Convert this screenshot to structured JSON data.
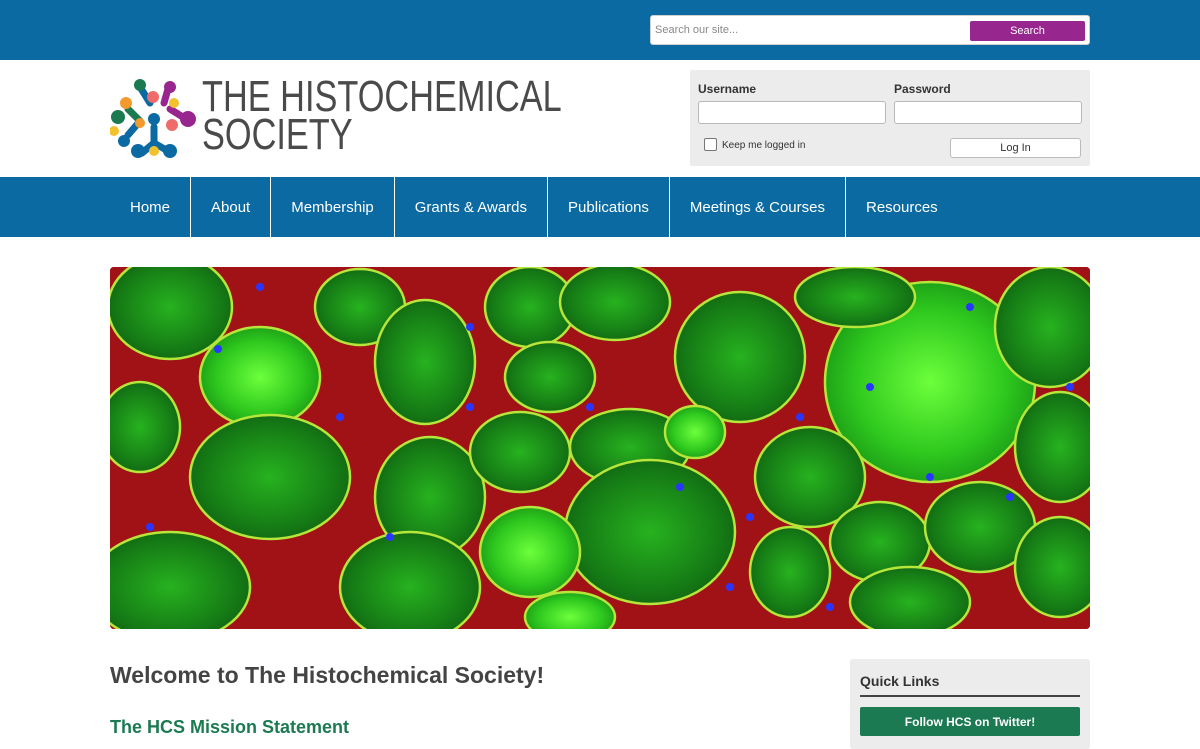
{
  "search": {
    "placeholder": "Search our site...",
    "button_label": "Search"
  },
  "brand": {
    "line1": "THE HISTOCHEMICAL",
    "line2": "SOCIETY"
  },
  "login": {
    "username_label": "Username",
    "password_label": "Password",
    "keep_logged_in_label": "Keep me logged in",
    "login_button": "Log In"
  },
  "nav": {
    "items": [
      {
        "label": "Home"
      },
      {
        "label": "About"
      },
      {
        "label": "Membership"
      },
      {
        "label": "Grants & Awards"
      },
      {
        "label": "Publications"
      },
      {
        "label": "Meetings & Courses"
      },
      {
        "label": "Resources"
      }
    ]
  },
  "main": {
    "welcome_heading": "Welcome to The Histochemical Society!",
    "mission_heading": "The HCS Mission Statement"
  },
  "quick_links": {
    "title": "Quick Links",
    "twitter_button": "Follow HCS on Twitter!"
  },
  "colors": {
    "brand_blue": "#0a6aa1",
    "search_purple": "#97278f",
    "accent_green": "#1b7a52"
  }
}
